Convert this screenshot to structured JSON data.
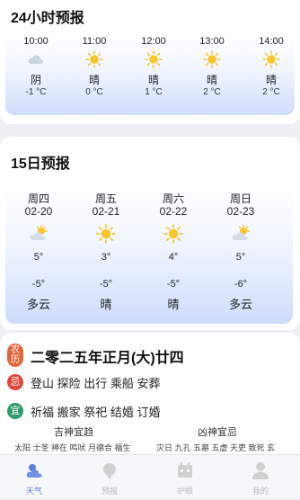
{
  "hourly": {
    "title": "24小时预报",
    "items": [
      {
        "time": "10:00",
        "condition": "阴",
        "temp": "-1 °C",
        "icon": "cloud-icon"
      },
      {
        "time": "11:00",
        "condition": "晴",
        "temp": "0 °C",
        "icon": "sun-icon"
      },
      {
        "time": "12:00",
        "condition": "晴",
        "temp": "1 °C",
        "icon": "sun-icon"
      },
      {
        "time": "13:00",
        "condition": "晴",
        "temp": "2 °C",
        "icon": "sun-icon"
      },
      {
        "time": "14:00",
        "condition": "晴",
        "temp": "2 °C",
        "icon": "sun-icon"
      }
    ]
  },
  "daily": {
    "title": "15日预报",
    "items": [
      {
        "weekday": "周四",
        "date": "02-20",
        "high": "5°",
        "low": "-5°",
        "condition": "多云",
        "icon": "partly-cloudy-icon"
      },
      {
        "weekday": "周五",
        "date": "02-21",
        "high": "3°",
        "low": "-5°",
        "condition": "晴",
        "icon": "sun-icon"
      },
      {
        "weekday": "周六",
        "date": "02-22",
        "high": "4°",
        "low": "-5°",
        "condition": "晴",
        "icon": "sun-icon"
      },
      {
        "weekday": "周日",
        "date": "02-23",
        "high": "5°",
        "low": "-6°",
        "condition": "多云",
        "icon": "partly-cloudy-icon"
      }
    ]
  },
  "calendar": {
    "lunar_badge": "农历",
    "lunar_date": "二零二五年正月(大)廿四",
    "ji_badge": "忌",
    "ji_text": "登山 探险 出行 乘船 安葬",
    "yi_badge": "宜",
    "yi_text": "祈福 搬家 祭祀 结婚 订婚",
    "good_gods_title": "吉神宜趋",
    "bad_gods_title": "凶神宜忌",
    "good_gods": "太阳 士圣 神在 鸣吠 月德合 福生",
    "bad_gods": "灾日 九孔 五墓 五虚 天吏 致死 玄"
  },
  "nav": {
    "items": [
      {
        "label": "天气",
        "icon": "weather-icon"
      },
      {
        "label": "预报",
        "icon": "forecast-icon"
      },
      {
        "label": "护眼",
        "icon": "eye-care-icon"
      },
      {
        "label": "我的",
        "icon": "profile-icon"
      }
    ]
  },
  "colors": {
    "accent": "#5b7fdd",
    "sun": "#f7c531",
    "cloud": "#c9d3e2",
    "lunar_badge": "#e2663f",
    "ji_badge": "#e0473a",
    "yi_badge": "#2f9a6a"
  }
}
